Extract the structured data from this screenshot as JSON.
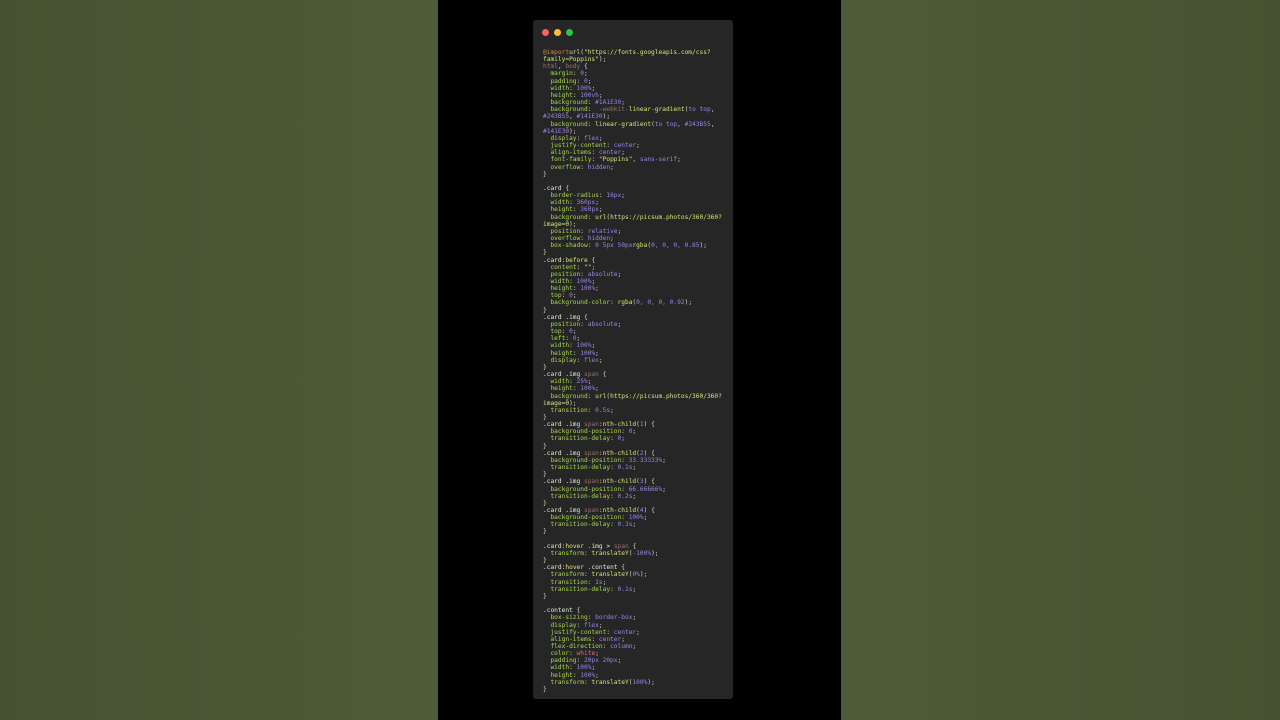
{
  "window": {
    "dot_colors": [
      "#ff5f57",
      "#febc2e",
      "#28c840"
    ]
  },
  "code_lines": [
    [
      [
        "at",
        "@import"
      ],
      [
        "",
        "url("
      ],
      [
        "str",
        "\"https://fonts.googleapis.com/css?"
      ]
    ],
    [
      [
        "str",
        "family=Poppins\""
      ],
      [
        "",
        ");"
      ]
    ],
    [
      [
        "tag",
        "html"
      ],
      [
        "",
        ", "
      ],
      [
        "tag",
        "body"
      ],
      [
        "",
        " {"
      ]
    ],
    [
      [
        "",
        "  "
      ],
      [
        "prop",
        "margin"
      ],
      [
        "",
        ": "
      ],
      [
        "num",
        "0"
      ],
      [
        "",
        ";"
      ]
    ],
    [
      [
        "",
        "  "
      ],
      [
        "prop",
        "padding"
      ],
      [
        "",
        ": "
      ],
      [
        "num",
        "0"
      ],
      [
        "",
        ";"
      ]
    ],
    [
      [
        "",
        "  "
      ],
      [
        "prop",
        "width"
      ],
      [
        "",
        ": "
      ],
      [
        "num",
        "100%"
      ],
      [
        "",
        ";"
      ]
    ],
    [
      [
        "",
        "  "
      ],
      [
        "prop",
        "height"
      ],
      [
        "",
        ": "
      ],
      [
        "num",
        "100vh"
      ],
      [
        "",
        ";"
      ]
    ],
    [
      [
        "",
        "  "
      ],
      [
        "prop",
        "background"
      ],
      [
        "",
        ": "
      ],
      [
        "num",
        "#1A1E30"
      ],
      [
        "",
        ";"
      ]
    ],
    [
      [
        "",
        "  "
      ],
      [
        "prop",
        "background"
      ],
      [
        "",
        ":  "
      ],
      [
        "tag",
        "-webkit-"
      ],
      [
        "fn",
        "linear-gradient"
      ],
      [
        "",
        "("
      ],
      [
        "val",
        "to top"
      ],
      [
        "",
        ","
      ]
    ],
    [
      [
        "num",
        "#243B55"
      ],
      [
        "",
        ", "
      ],
      [
        "num",
        "#141E30"
      ],
      [
        "",
        ");"
      ]
    ],
    [
      [
        "",
        "  "
      ],
      [
        "prop",
        "background"
      ],
      [
        "",
        ": "
      ],
      [
        "fn",
        "linear-gradient"
      ],
      [
        "",
        "("
      ],
      [
        "val",
        "to top"
      ],
      [
        "",
        ", "
      ],
      [
        "num",
        "#243B55"
      ],
      [
        "",
        ","
      ]
    ],
    [
      [
        "num",
        "#141E30"
      ],
      [
        "",
        ");"
      ]
    ],
    [
      [
        "",
        "  "
      ],
      [
        "prop",
        "display"
      ],
      [
        "",
        ": "
      ],
      [
        "val",
        "flex"
      ],
      [
        "",
        ";"
      ]
    ],
    [
      [
        "",
        "  "
      ],
      [
        "prop",
        "justify-content"
      ],
      [
        "",
        ": "
      ],
      [
        "val",
        "center"
      ],
      [
        "",
        ";"
      ]
    ],
    [
      [
        "",
        "  "
      ],
      [
        "prop",
        "align-items"
      ],
      [
        "",
        ": "
      ],
      [
        "val",
        "center"
      ],
      [
        "",
        ";"
      ]
    ],
    [
      [
        "",
        "  "
      ],
      [
        "prop",
        "font-family"
      ],
      [
        "",
        ": "
      ],
      [
        "str",
        "\"Poppins\""
      ],
      [
        "",
        ", "
      ],
      [
        "val",
        "sans-serif"
      ],
      [
        "",
        ";"
      ]
    ],
    [
      [
        "",
        "  "
      ],
      [
        "prop",
        "overflow"
      ],
      [
        "",
        ": "
      ],
      [
        "val",
        "hidden"
      ],
      [
        "",
        ";"
      ]
    ],
    [
      [
        "",
        "}"
      ]
    ],
    [
      [
        "",
        ""
      ]
    ],
    [
      [
        "sel",
        ".card"
      ],
      [
        "",
        " {"
      ]
    ],
    [
      [
        "",
        "  "
      ],
      [
        "prop",
        "border-radius"
      ],
      [
        "",
        ": "
      ],
      [
        "num",
        "16px"
      ],
      [
        "",
        ";"
      ]
    ],
    [
      [
        "",
        "  "
      ],
      [
        "prop",
        "width"
      ],
      [
        "",
        ": "
      ],
      [
        "num",
        "360px"
      ],
      [
        "",
        ";"
      ]
    ],
    [
      [
        "",
        "  "
      ],
      [
        "prop",
        "height"
      ],
      [
        "",
        ": "
      ],
      [
        "num",
        "360px"
      ],
      [
        "",
        ";"
      ]
    ],
    [
      [
        "",
        "  "
      ],
      [
        "prop",
        "background"
      ],
      [
        "",
        ": "
      ],
      [
        "fn",
        "url"
      ],
      [
        "",
        "("
      ],
      [
        "str",
        "https://picsum.photos/360/360?"
      ]
    ],
    [
      [
        "str",
        "image=0"
      ],
      [
        "",
        ");"
      ]
    ],
    [
      [
        "",
        "  "
      ],
      [
        "prop",
        "position"
      ],
      [
        "",
        ": "
      ],
      [
        "val",
        "relative"
      ],
      [
        "",
        ";"
      ]
    ],
    [
      [
        "",
        "  "
      ],
      [
        "prop",
        "overflow"
      ],
      [
        "",
        ": "
      ],
      [
        "val",
        "hidden"
      ],
      [
        "",
        ";"
      ]
    ],
    [
      [
        "",
        "  "
      ],
      [
        "prop",
        "box-shadow"
      ],
      [
        "",
        ": "
      ],
      [
        "num",
        "0 5px 50px"
      ],
      [
        "",
        "",
        " "
      ],
      [
        "fn",
        "rgba"
      ],
      [
        "",
        "("
      ],
      [
        "num",
        "0, 0, 0, 0.85"
      ],
      [
        "",
        ");"
      ]
    ],
    [
      [
        "",
        "}"
      ]
    ],
    [
      [
        "sel",
        ".card"
      ],
      [
        "fn",
        ":before"
      ],
      [
        "",
        " {"
      ]
    ],
    [
      [
        "",
        "  "
      ],
      [
        "prop",
        "content"
      ],
      [
        "",
        ": "
      ],
      [
        "str",
        "\"\""
      ],
      [
        "",
        ";"
      ]
    ],
    [
      [
        "",
        "  "
      ],
      [
        "prop",
        "position"
      ],
      [
        "",
        ": "
      ],
      [
        "val",
        "absolute"
      ],
      [
        "",
        ";"
      ]
    ],
    [
      [
        "",
        "  "
      ],
      [
        "prop",
        "width"
      ],
      [
        "",
        ": "
      ],
      [
        "num",
        "100%"
      ],
      [
        "",
        ";"
      ]
    ],
    [
      [
        "",
        "  "
      ],
      [
        "prop",
        "height"
      ],
      [
        "",
        ": "
      ],
      [
        "num",
        "100%"
      ],
      [
        "",
        ";"
      ]
    ],
    [
      [
        "",
        "  "
      ],
      [
        "prop",
        "top"
      ],
      [
        "",
        ": "
      ],
      [
        "num",
        "0"
      ],
      [
        "",
        ";"
      ]
    ],
    [
      [
        "",
        "  "
      ],
      [
        "prop",
        "background-color"
      ],
      [
        "",
        ": "
      ],
      [
        "fn",
        "rgba"
      ],
      [
        "",
        "("
      ],
      [
        "num",
        "0, 0, 0, 0.92"
      ],
      [
        "",
        ");"
      ]
    ],
    [
      [
        "",
        "}"
      ]
    ],
    [
      [
        "sel",
        ".card .img"
      ],
      [
        "",
        " {"
      ]
    ],
    [
      [
        "",
        "  "
      ],
      [
        "prop",
        "position"
      ],
      [
        "",
        ": "
      ],
      [
        "val",
        "absolute"
      ],
      [
        "",
        ";"
      ]
    ],
    [
      [
        "",
        "  "
      ],
      [
        "prop",
        "top"
      ],
      [
        "",
        ": "
      ],
      [
        "num",
        "0"
      ],
      [
        "",
        ";"
      ]
    ],
    [
      [
        "",
        "  "
      ],
      [
        "prop",
        "left"
      ],
      [
        "",
        ": "
      ],
      [
        "num",
        "0"
      ],
      [
        "",
        ";"
      ]
    ],
    [
      [
        "",
        "  "
      ],
      [
        "prop",
        "width"
      ],
      [
        "",
        ": "
      ],
      [
        "num",
        "100%"
      ],
      [
        "",
        ";"
      ]
    ],
    [
      [
        "",
        "  "
      ],
      [
        "prop",
        "height"
      ],
      [
        "",
        ": "
      ],
      [
        "num",
        "100%"
      ],
      [
        "",
        ";"
      ]
    ],
    [
      [
        "",
        "  "
      ],
      [
        "prop",
        "display"
      ],
      [
        "",
        ": "
      ],
      [
        "val",
        "flex"
      ],
      [
        "",
        ";"
      ]
    ],
    [
      [
        "",
        "}"
      ]
    ],
    [
      [
        "sel",
        ".card .img "
      ],
      [
        "tag",
        "span"
      ],
      [
        "",
        " {"
      ]
    ],
    [
      [
        "",
        "  "
      ],
      [
        "prop",
        "width"
      ],
      [
        "",
        ": "
      ],
      [
        "num",
        "25%"
      ],
      [
        "",
        ";"
      ]
    ],
    [
      [
        "",
        "  "
      ],
      [
        "prop",
        "height"
      ],
      [
        "",
        ": "
      ],
      [
        "num",
        "100%"
      ],
      [
        "",
        ";"
      ]
    ],
    [
      [
        "",
        "  "
      ],
      [
        "prop",
        "background"
      ],
      [
        "",
        ": "
      ],
      [
        "fn",
        "url"
      ],
      [
        "",
        "("
      ],
      [
        "str",
        "https://picsum.photos/360/360?"
      ]
    ],
    [
      [
        "str",
        "image=0"
      ],
      [
        "",
        ");"
      ]
    ],
    [
      [
        "",
        "  "
      ],
      [
        "prop",
        "transition"
      ],
      [
        "",
        ": "
      ],
      [
        "num",
        "0.5s"
      ],
      [
        "",
        ";"
      ]
    ],
    [
      [
        "",
        "}"
      ]
    ],
    [
      [
        "sel",
        ".card .img "
      ],
      [
        "tag",
        "span"
      ],
      [
        "fn",
        ":nth-child"
      ],
      [
        "",
        "("
      ],
      [
        "num",
        "1"
      ],
      [
        "",
        ") {"
      ]
    ],
    [
      [
        "",
        "  "
      ],
      [
        "prop",
        "background-position"
      ],
      [
        "",
        ": "
      ],
      [
        "num",
        "0"
      ],
      [
        "",
        ";"
      ]
    ],
    [
      [
        "",
        "  "
      ],
      [
        "prop",
        "transition-delay"
      ],
      [
        "",
        ": "
      ],
      [
        "num",
        "0"
      ],
      [
        "",
        ";"
      ]
    ],
    [
      [
        "",
        "}"
      ]
    ],
    [
      [
        "sel",
        ".card .img "
      ],
      [
        "tag",
        "span"
      ],
      [
        "fn",
        ":nth-child"
      ],
      [
        "",
        "("
      ],
      [
        "num",
        "2"
      ],
      [
        "",
        ") {"
      ]
    ],
    [
      [
        "",
        "  "
      ],
      [
        "prop",
        "background-position"
      ],
      [
        "",
        ": "
      ],
      [
        "num",
        "33.33333%"
      ],
      [
        "",
        ";"
      ]
    ],
    [
      [
        "",
        "  "
      ],
      [
        "prop",
        "transition-delay"
      ],
      [
        "",
        ": "
      ],
      [
        "num",
        "0.1s"
      ],
      [
        "",
        ";"
      ]
    ],
    [
      [
        "",
        "}"
      ]
    ],
    [
      [
        "sel",
        ".card .img "
      ],
      [
        "tag",
        "span"
      ],
      [
        "fn",
        ":nth-child"
      ],
      [
        "",
        "("
      ],
      [
        "num",
        "3"
      ],
      [
        "",
        ") {"
      ]
    ],
    [
      [
        "",
        "  "
      ],
      [
        "prop",
        "background-position"
      ],
      [
        "",
        ": "
      ],
      [
        "num",
        "66.66666%"
      ],
      [
        "",
        ";"
      ]
    ],
    [
      [
        "",
        "  "
      ],
      [
        "prop",
        "transition-delay"
      ],
      [
        "",
        ": "
      ],
      [
        "num",
        "0.2s"
      ],
      [
        "",
        ";"
      ]
    ],
    [
      [
        "",
        "}"
      ]
    ],
    [
      [
        "sel",
        ".card .img "
      ],
      [
        "tag",
        "span"
      ],
      [
        "fn",
        ":nth-child"
      ],
      [
        "",
        "("
      ],
      [
        "num",
        "4"
      ],
      [
        "",
        ") {"
      ]
    ],
    [
      [
        "",
        "  "
      ],
      [
        "prop",
        "background-position"
      ],
      [
        "",
        ": "
      ],
      [
        "num",
        "100%"
      ],
      [
        "",
        ";"
      ]
    ],
    [
      [
        "",
        "  "
      ],
      [
        "prop",
        "transition-delay"
      ],
      [
        "",
        ": "
      ],
      [
        "num",
        "0.3s"
      ],
      [
        "",
        ";"
      ]
    ],
    [
      [
        "",
        "}"
      ]
    ],
    [
      [
        "",
        ""
      ]
    ],
    [
      [
        "sel",
        ".card"
      ],
      [
        "fn",
        ":hover"
      ],
      [
        "sel",
        " .img > "
      ],
      [
        "tag",
        "span"
      ],
      [
        "",
        " {"
      ]
    ],
    [
      [
        "",
        "  "
      ],
      [
        "prop",
        "transform"
      ],
      [
        "",
        ": "
      ],
      [
        "fn",
        "translateY"
      ],
      [
        "",
        "("
      ],
      [
        "num",
        "-100%"
      ],
      [
        "",
        ");"
      ]
    ],
    [
      [
        "",
        "}"
      ]
    ],
    [
      [
        "sel",
        ".card"
      ],
      [
        "fn",
        ":hover"
      ],
      [
        "sel",
        " .content"
      ],
      [
        "",
        " {"
      ]
    ],
    [
      [
        "",
        "  "
      ],
      [
        "prop",
        "transform"
      ],
      [
        "",
        ": "
      ],
      [
        "fn",
        "translateY"
      ],
      [
        "",
        "("
      ],
      [
        "num",
        "0%"
      ],
      [
        "",
        ");"
      ]
    ],
    [
      [
        "",
        "  "
      ],
      [
        "prop",
        "transition"
      ],
      [
        "",
        ": "
      ],
      [
        "num",
        "1s"
      ],
      [
        "",
        ";"
      ]
    ],
    [
      [
        "",
        "  "
      ],
      [
        "prop",
        "transition-delay"
      ],
      [
        "",
        ": "
      ],
      [
        "num",
        "0.1s"
      ],
      [
        "",
        ";"
      ]
    ],
    [
      [
        "",
        "}"
      ]
    ],
    [
      [
        "",
        ""
      ]
    ],
    [
      [
        "sel",
        ".content"
      ],
      [
        "",
        " {"
      ]
    ],
    [
      [
        "",
        "  "
      ],
      [
        "prop",
        "box-sizing"
      ],
      [
        "",
        ": "
      ],
      [
        "val",
        "border-box"
      ],
      [
        "",
        ";"
      ]
    ],
    [
      [
        "",
        "  "
      ],
      [
        "prop",
        "display"
      ],
      [
        "",
        ": "
      ],
      [
        "val",
        "flex"
      ],
      [
        "",
        ";"
      ]
    ],
    [
      [
        "",
        "  "
      ],
      [
        "prop",
        "justify-content"
      ],
      [
        "",
        ": "
      ],
      [
        "val",
        "center"
      ],
      [
        "",
        ";"
      ]
    ],
    [
      [
        "",
        "  "
      ],
      [
        "prop",
        "align-items"
      ],
      [
        "",
        ": "
      ],
      [
        "val",
        "center"
      ],
      [
        "",
        ";"
      ]
    ],
    [
      [
        "",
        "  "
      ],
      [
        "prop",
        "flex-direction"
      ],
      [
        "",
        ": "
      ],
      [
        "val",
        "column"
      ],
      [
        "",
        ";"
      ]
    ],
    [
      [
        "",
        "  "
      ],
      [
        "prop",
        "color"
      ],
      [
        "",
        ": "
      ],
      [
        "kw",
        "white"
      ],
      [
        "",
        ";"
      ]
    ],
    [
      [
        "",
        "  "
      ],
      [
        "prop",
        "padding"
      ],
      [
        "",
        ": "
      ],
      [
        "num",
        "20px 20px"
      ],
      [
        "",
        ";"
      ]
    ],
    [
      [
        "",
        "  "
      ],
      [
        "prop",
        "width"
      ],
      [
        "",
        ": "
      ],
      [
        "num",
        "100%"
      ],
      [
        "",
        ";"
      ]
    ],
    [
      [
        "",
        "  "
      ],
      [
        "prop",
        "height"
      ],
      [
        "",
        ": "
      ],
      [
        "num",
        "100%"
      ],
      [
        "",
        ";"
      ]
    ],
    [
      [
        "",
        "  "
      ],
      [
        "prop",
        "transform"
      ],
      [
        "",
        ": "
      ],
      [
        "fn",
        "translateY"
      ],
      [
        "",
        "("
      ],
      [
        "num",
        "100%"
      ],
      [
        "",
        ");"
      ]
    ],
    [
      [
        "",
        "}"
      ]
    ]
  ]
}
